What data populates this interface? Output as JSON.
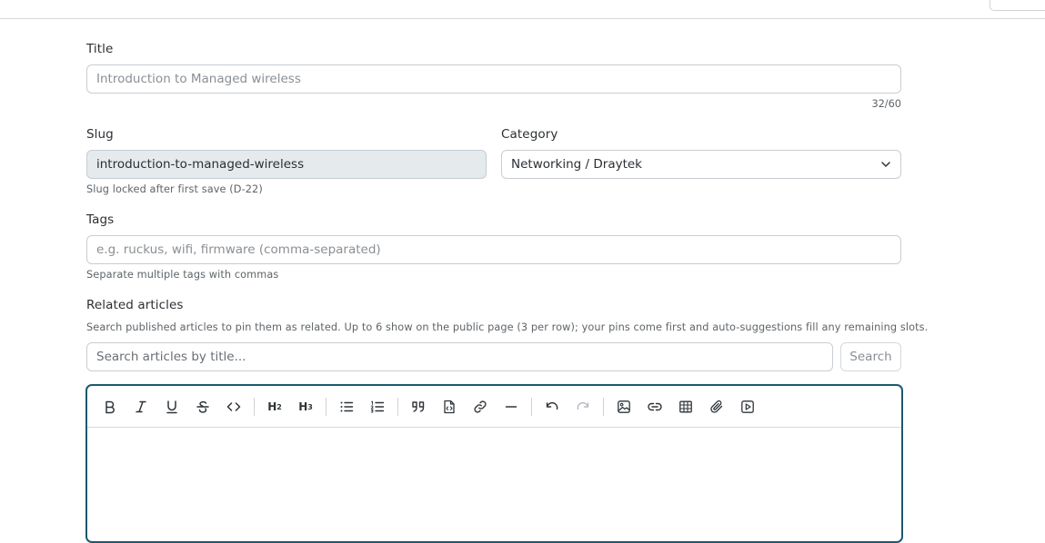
{
  "form": {
    "title": {
      "label": "Title",
      "placeholder": "Introduction to Managed wireless",
      "counter": "32/60"
    },
    "slug": {
      "label": "Slug",
      "value": "introduction-to-managed-wireless",
      "help": "Slug locked after first save (D-22)"
    },
    "category": {
      "label": "Category",
      "value": "Networking / Draytek"
    },
    "tags": {
      "label": "Tags",
      "placeholder": "e.g. ruckus, wifi, firmware (comma-separated)",
      "help": "Separate multiple tags with commas"
    },
    "related": {
      "label": "Related articles",
      "help": "Search published articles to pin them as related. Up to 6 show on the public page (3 per row); your pins come first and auto-suggestions fill any remaining slots.",
      "search_placeholder": "Search articles by title...",
      "search_button": "Search"
    }
  },
  "editor": {
    "toolbar": [
      {
        "name": "bold-icon",
        "glyph": "B"
      },
      {
        "name": "italic-icon",
        "glyph": "I"
      },
      {
        "name": "underline-icon",
        "glyph": "U"
      },
      {
        "name": "strikethrough-icon",
        "glyph": "S"
      },
      {
        "name": "code-icon",
        "glyph": "<>"
      },
      {
        "name": "heading-2-icon",
        "glyph": "H2"
      },
      {
        "name": "heading-3-icon",
        "glyph": "H3"
      },
      {
        "name": "bullet-list-icon",
        "glyph": "list"
      },
      {
        "name": "ordered-list-icon",
        "glyph": "olist"
      },
      {
        "name": "blockquote-icon",
        "glyph": "quote"
      },
      {
        "name": "code-block-icon",
        "glyph": "file-code"
      },
      {
        "name": "link-icon",
        "glyph": "link"
      },
      {
        "name": "horizontal-rule-icon",
        "glyph": "rule"
      },
      {
        "name": "undo-icon",
        "glyph": "undo"
      },
      {
        "name": "redo-icon",
        "glyph": "redo",
        "disabled": true
      },
      {
        "name": "image-icon",
        "glyph": "image"
      },
      {
        "name": "embed-link-icon",
        "glyph": "link2"
      },
      {
        "name": "table-icon",
        "glyph": "table"
      },
      {
        "name": "attachment-icon",
        "glyph": "paperclip"
      },
      {
        "name": "video-icon",
        "glyph": "video"
      }
    ],
    "accent_color": "#1e5870"
  }
}
